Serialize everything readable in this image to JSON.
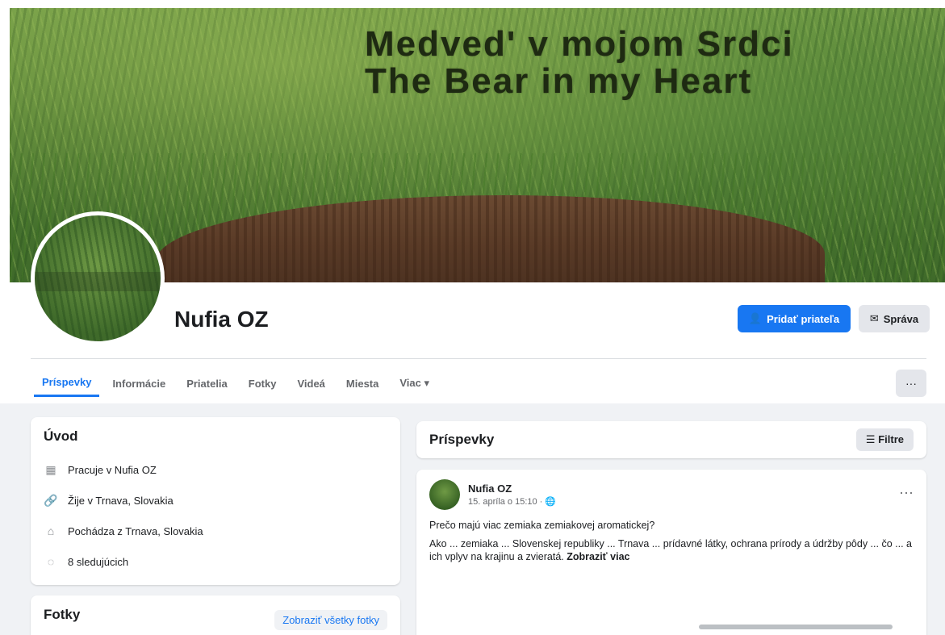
{
  "cover": {
    "title_line1": "Medved' v mojom Srdci",
    "title_line2": "The Bear in my Heart"
  },
  "profile": {
    "name": "Nufia OZ",
    "primary_button": "Pridať priateľa",
    "secondary_button": "Správa"
  },
  "tabs": [
    {
      "label": "Príspevky",
      "active": true
    },
    {
      "label": "Informácie"
    },
    {
      "label": "Priatelia"
    },
    {
      "label": "Fotky"
    },
    {
      "label": "Videá"
    },
    {
      "label": "Miesta"
    },
    {
      "label": "Viac ▾"
    }
  ],
  "tabs_more_label": "···",
  "intro": {
    "title": "Úvod",
    "rows": [
      {
        "icon": "briefcase-icon",
        "glyph": "▦",
        "text": "Pracuje v Nufia OZ"
      },
      {
        "icon": "link-icon",
        "glyph": "🔗",
        "text": "Žije v Trnava, Slovakia"
      },
      {
        "icon": "home-icon",
        "glyph": "⌂",
        "text": "Pochádza z Trnava, Slovakia"
      },
      {
        "icon": "followers-icon",
        "glyph": "◌",
        "text": "8 sledujúcich"
      }
    ]
  },
  "photos": {
    "title": "Fotky",
    "link": "Zobraziť všetky fotky"
  },
  "posts": {
    "title": "Príspevky",
    "filter_button": "Filtre",
    "items": [
      {
        "author": "Nufia OZ",
        "meta": "15. apríla o 15:10 · 🌐",
        "question": "Prečo majú viac zemiaka zemiakovej aromatickej?",
        "body": "Ako ... zemiaka ... Slovenskej republiky ... Trnava ... prídavné látky, ochrana prírody a údržby pôdy ... čo ... a ich vplyv na krajinu a zvieratá.",
        "more": "Zobraziť viac"
      }
    ]
  },
  "colors": {
    "accent": "#1877f2",
    "page_bg": "#f0f2f5",
    "card_bg": "#ffffff"
  }
}
